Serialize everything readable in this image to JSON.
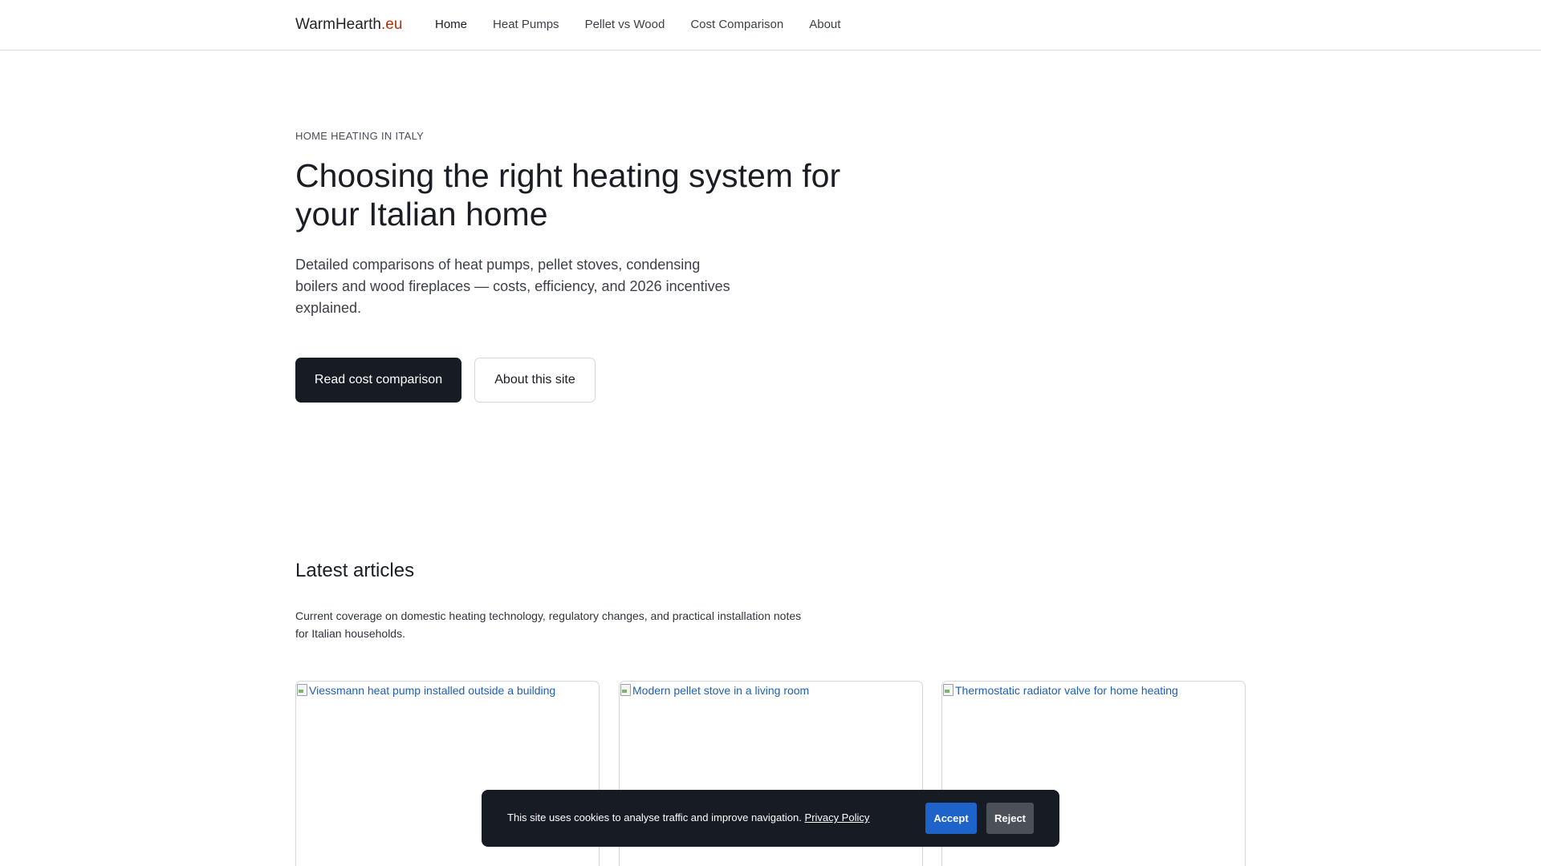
{
  "header": {
    "brand_name": "WarmHearth",
    "brand_tld": ".eu",
    "nav": [
      {
        "label": "Home"
      },
      {
        "label": "Heat Pumps"
      },
      {
        "label": "Pellet vs Wood"
      },
      {
        "label": "Cost Comparison"
      },
      {
        "label": "About"
      }
    ]
  },
  "hero": {
    "eyebrow": "HOME HEATING IN ITALY",
    "title": "Choosing the right heating system for your Italian home",
    "lead": "Detailed comparisons of heat pumps, pellet stoves, condensing boilers and wood fireplaces — costs, efficiency, and 2026 incentives explained.",
    "primary_button": "Read cost comparison",
    "secondary_button": "About this site"
  },
  "articles": {
    "title": "Latest articles",
    "lead": "Current coverage on domestic heating technology, regulatory changes, and practical installation notes for Italian households.",
    "cards": [
      {
        "image_alt": "Viessmann heat pump installed outside a building"
      },
      {
        "image_alt": "Modern pellet stove in a living room"
      },
      {
        "image_alt": "Thermostatic radiator valve for home heating"
      }
    ]
  },
  "cookie_banner": {
    "text": "This site uses cookies to analyse traffic and improve navigation. ",
    "policy_link": "Privacy Policy",
    "accept": "Accept",
    "reject": "Reject"
  },
  "colors": {
    "brand_accent": "#b5300b",
    "primary_button": "#161b24",
    "accept_button": "#1d63c9",
    "reject_button": "#4b5059"
  }
}
